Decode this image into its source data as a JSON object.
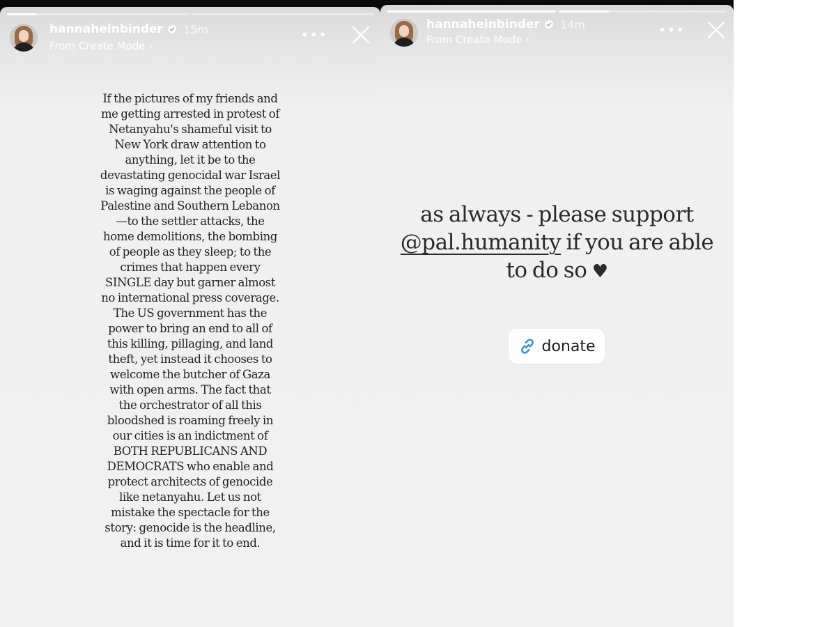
{
  "stories": [
    {
      "username": "hannaheinbinder",
      "time": "15m",
      "subtitle": "From Create Mode ›",
      "progress": [
        0.16,
        0
      ],
      "text": "If the pictures of my friends and me getting arrested in protest of Netanyahu's shameful visit to New York draw attention to anything, let it be to the devastating genocidal war Israel is waging against the people of Palestine and Southern Lebanon—to the settler attacks, the home demolitions, the bombing of people as they sleep; to the crimes that happen every SINGLE day but garner almost no international press coverage. The US government has the power to bring an end to all of this killing, pillaging, and land theft, yet instead it chooses to welcome the butcher of Gaza with open arms. The fact that the orchestrator of all this bloodshed is roaming freely in our cities is an indictment of BOTH REPUBLICANS AND DEMOCRATS who enable and protect architects of genocide like netanyahu. Let us not mistake the spectacle for the story: genocide is the headline, and it is time for it to end."
    },
    {
      "username": "hannaheinbinder",
      "time": "14m",
      "subtitle": "From Create Mode ›",
      "progress": [
        1,
        0.3
      ],
      "text_line1": "as always - please support",
      "mention": "@pal.humanity",
      "text_line2_rest": " if you are able",
      "text_line3": "to do so",
      "heart": "♥",
      "link_label": "donate"
    }
  ],
  "colors": {
    "background": "#0b0b0d",
    "story_bg": "#f1f1f1",
    "text": "#222222",
    "link_blue": "#3b8ee8"
  },
  "icons": [
    "verified-badge-icon",
    "more-options-icon",
    "close-icon",
    "link-icon"
  ]
}
